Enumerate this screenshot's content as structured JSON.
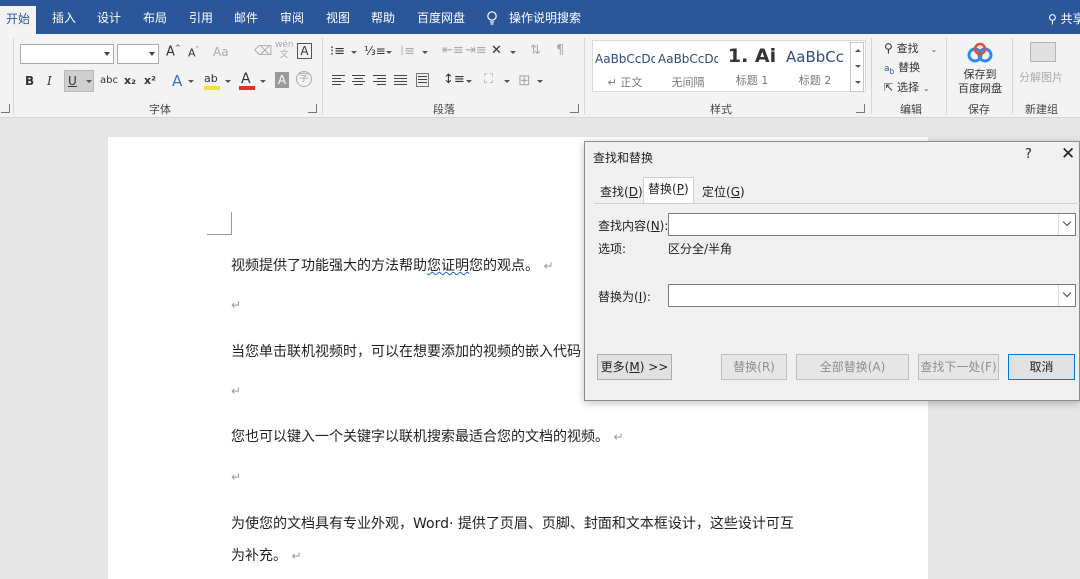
{
  "tabs": {
    "home": "开始",
    "insert": "插入",
    "design": "设计",
    "layout": "布局",
    "references": "引用",
    "mailings": "邮件",
    "review": "审阅",
    "view": "视图",
    "help": "帮助",
    "baidu": "百度网盘",
    "tell_me": "操作说明搜索",
    "share": "共享"
  },
  "ribbon": {
    "font_group": {
      "label": "字体",
      "font_name": "",
      "font_size": "",
      "grow": "A",
      "shrink": "A",
      "case": "Aa",
      "phonetic": "wén",
      "phonetic_small": "文",
      "border_char": "A",
      "bold": "B",
      "italic": "I",
      "underline": "U",
      "strike": "abc",
      "sub": "x₂",
      "sup": "x²",
      "effects": "A",
      "highlight": "ab",
      "color": "A",
      "shade_char": "A",
      "encircle": "字"
    },
    "paragraph_group": {
      "label": "段落"
    },
    "styles_group": {
      "label": "样式",
      "items": [
        {
          "sample": "AaBbCcDd",
          "name": "↵ 正文"
        },
        {
          "sample": "AaBbCcDd",
          "name": "无间隔"
        },
        {
          "sample": "1.  Ai",
          "name": "标题 1"
        },
        {
          "sample": "AaBbCc",
          "name": "标题 2"
        }
      ]
    },
    "editing_group": {
      "label": "编辑",
      "find": "查找",
      "replace": "替换",
      "select": "选择"
    },
    "save_group": {
      "label": "保存",
      "save_to_line1": "保存到",
      "save_to_line2": "百度网盘"
    },
    "new_group": {
      "label": "新建组",
      "split_image": "分解图片"
    }
  },
  "document": {
    "p1_a": "视频提供了功能强大的方法帮助",
    "p1_err": "您证明",
    "p1_b": "您的观点。",
    "p2": "当您单击联机视频时，可以在想要添加的视频的嵌入代码",
    "p3": "您也可以键入一个关键字以联机搜索最适合您的文档的视频。",
    "p4_line1": "为使您的文档具有专业外观，Word· 提供了页眉、页脚、封面和文本框设计，这些设计可互",
    "p4_line2": "为补充。",
    "para_mark": "↵"
  },
  "dialog": {
    "title": "查找和替换",
    "help": "?",
    "close": "✕",
    "tabs": [
      {
        "label": "查找(",
        "key": "D",
        "end": ")"
      },
      {
        "label": "替换(",
        "key": "P",
        "end": ")"
      },
      {
        "label": "定位(",
        "key": "G",
        "end": ")"
      }
    ],
    "find_label": {
      "text": "查找内容(",
      "key": "N",
      "end": "):"
    },
    "find_value": "",
    "options_label": "选项:",
    "options_value": "区分全/半角",
    "replace_label": {
      "text": "替换为(",
      "key": "I",
      "end": "):"
    },
    "replace_value": "",
    "buttons": {
      "more": {
        "text": "更多(",
        "key": "M",
        "end": ") >>"
      },
      "replace": "替换(R)",
      "replace_all": "全部替换(A)",
      "find_next": "查找下一处(F)",
      "cancel": "取消"
    }
  },
  "colors": {
    "title_bar": "#2b579a",
    "ribbon": "#f3f3f3",
    "canvas": "#e6e6e6",
    "font_color_bar": "#e03030",
    "highlight_bar": "#f4e23b"
  }
}
